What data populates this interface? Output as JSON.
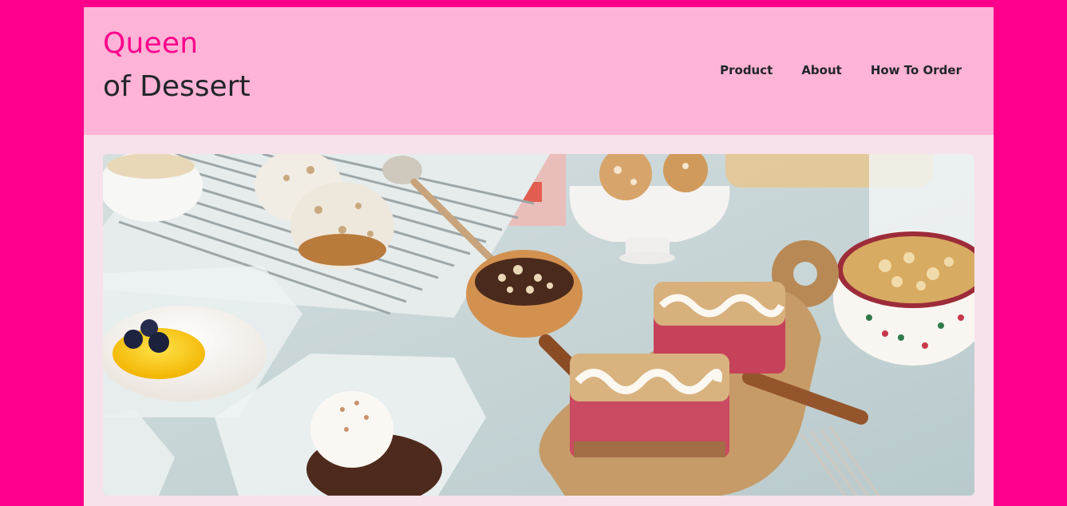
{
  "brand": {
    "line1": "Queen",
    "line2": "of Dessert"
  },
  "nav": {
    "items": [
      "Product",
      "About",
      "How To Order"
    ]
  },
  "hero": {
    "alt": "Assorted desserts: muffins on a cooling rack, tartlet, crumble bars on a wooden board, cups with lemon curd and chocolate mousse"
  },
  "colors": {
    "outer_bg": "#ff008c",
    "header_bg": "#ffb3d6",
    "page_bg": "#f7e1ea",
    "brand_accent": "#ff008c",
    "text_dark": "#212529"
  }
}
